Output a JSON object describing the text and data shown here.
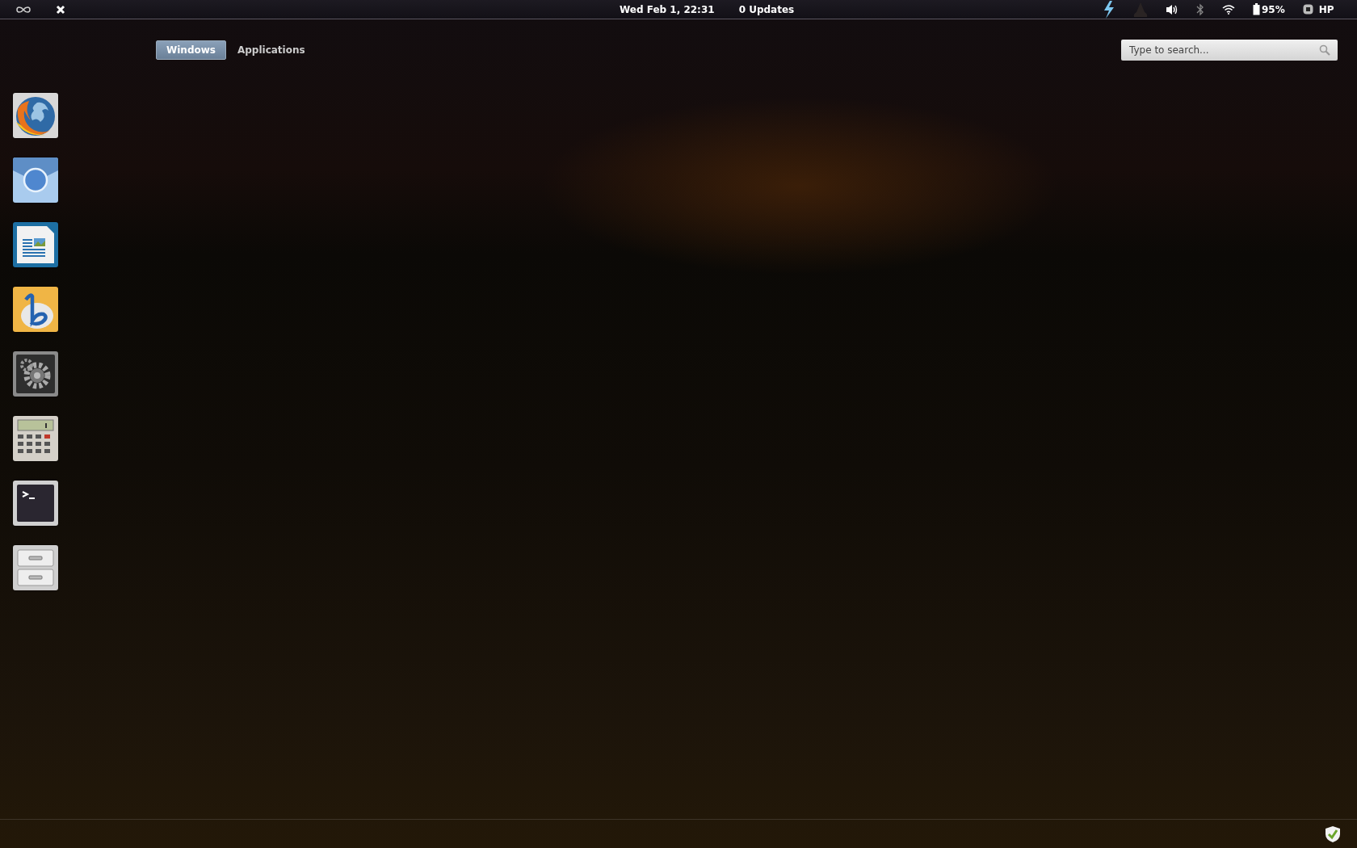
{
  "top_bar": {
    "clock": "Wed Feb  1, 22:31",
    "updates": "0 Updates",
    "battery": "95%",
    "user": "HP",
    "indicators": [
      {
        "kind": "power"
      },
      {
        "kind": "dim"
      },
      {
        "kind": "volume"
      },
      {
        "kind": "bluetooth"
      },
      {
        "kind": "wifi"
      }
    ]
  },
  "tabs": [
    {
      "label": "Windows",
      "selected": true
    },
    {
      "label": "Applications",
      "selected": false
    }
  ],
  "search": {
    "placeholder": "Type to search..."
  },
  "dock": [
    {
      "kind": "browser"
    },
    {
      "kind": "circle"
    },
    {
      "kind": "document"
    },
    {
      "kind": "music"
    },
    {
      "kind": "settings"
    },
    {
      "kind": "calculator"
    },
    {
      "kind": "terminal"
    },
    {
      "kind": "cabinet"
    }
  ]
}
